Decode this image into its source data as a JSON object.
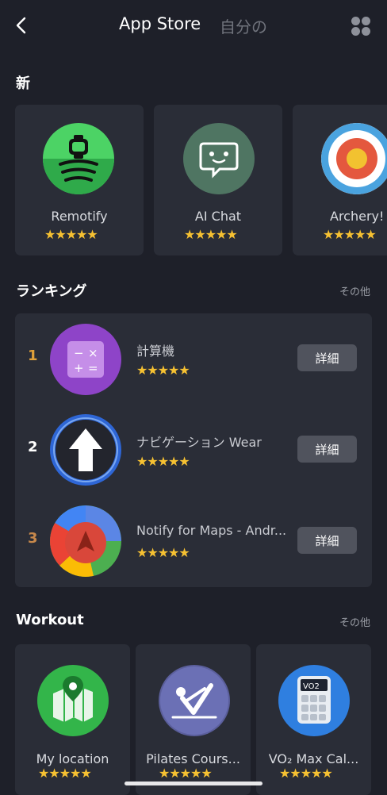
{
  "header": {
    "active_tab": "App Store",
    "inactive_tab": "自分の"
  },
  "new_section": {
    "title": "新",
    "apps": [
      {
        "name": "Remotify",
        "rating": "★★★★★"
      },
      {
        "name": "AI Chat",
        "rating": "★★★★★"
      },
      {
        "name": "Archery!",
        "rating": "★★★★★"
      }
    ]
  },
  "ranking_section": {
    "title": "ランキング",
    "more": "その他",
    "items": [
      {
        "rank": "1",
        "name": "計算機",
        "rating": "★★★★★",
        "button": "詳細",
        "rank_color": "#e0a13a"
      },
      {
        "rank": "2",
        "name": "ナビゲーション Wear",
        "rating": "★★★★★",
        "button": "詳細",
        "rank_color": "#ffffff"
      },
      {
        "rank": "3",
        "name": "Notify for Maps - Andr...",
        "rating": "★★★★★",
        "button": "詳細",
        "rank_color": "#c7884b"
      }
    ]
  },
  "workout_section": {
    "title": "Workout",
    "more": "その他",
    "apps": [
      {
        "name": "My location",
        "rating": "★★★★★"
      },
      {
        "name": "Pilates Cours...",
        "rating": "★★★★★"
      },
      {
        "name": "VO₂ Max Cal...",
        "rating": "★★★★★"
      }
    ]
  },
  "icons": {
    "remotify": "watch-music-icon",
    "ai_chat": "chat-bubble-icon",
    "archery": "target-icon",
    "calculator": "calculator-icon",
    "navigation": "navigation-arrow-icon",
    "maps": "maps-pointer-icon",
    "my_location": "map-pin-icon",
    "pilates": "pilates-pose-icon",
    "vo2": "vo2-calculator-icon"
  },
  "colors": {
    "background": "#1e2029",
    "card": "#2a2d37",
    "star": "#f6c132",
    "button": "#50535d"
  }
}
